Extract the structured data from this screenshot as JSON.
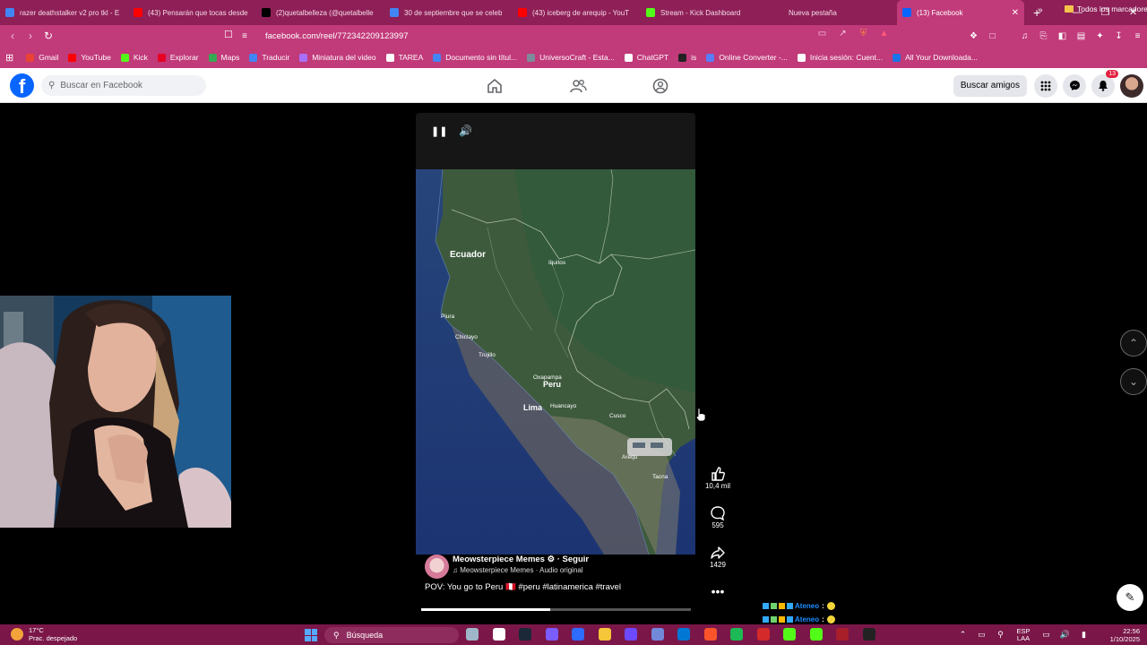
{
  "browser": {
    "tabs": [
      {
        "title": "razer deathstalker v2 pro tkl - E",
        "color": "#4285f4"
      },
      {
        "title": "(43) Pensarán que tocas desde",
        "color": "#ff0000"
      },
      {
        "title": "(2)quetalbelleza (@quetalbelle",
        "color": "#000000"
      },
      {
        "title": "30 de septiembre que se celeb",
        "color": "#4285f4"
      },
      {
        "title": "(43) iceberg de arequip - YouT",
        "color": "#ff0000"
      },
      {
        "title": "Stream - Kick Dashboard",
        "color": "#53fc18"
      },
      {
        "title": "Nueva pestaña",
        "color": "#8e1f57"
      },
      {
        "title": "(13) Facebook",
        "color": "#0866ff",
        "active": true
      }
    ],
    "url": "facebook.com/reel/772342209123997",
    "bookmarks": [
      {
        "label": "Gmail",
        "color": "#ea4335"
      },
      {
        "label": "YouTube",
        "color": "#ff0000"
      },
      {
        "label": "Kick",
        "color": "#53fc18"
      },
      {
        "label": "Explorar",
        "color": "#e60023"
      },
      {
        "label": "Maps",
        "color": "#34a853"
      },
      {
        "label": "Traducir",
        "color": "#4285f4"
      },
      {
        "label": "Miniatura del video",
        "color": "#a970ff"
      },
      {
        "label": "TAREA",
        "color": "#ffffff"
      },
      {
        "label": "Documento sin títul...",
        "color": "#4285f4"
      },
      {
        "label": "UniversoCraft - Esta...",
        "color": "#7d8b9c"
      },
      {
        "label": "ChatGPT",
        "color": "#ffffff"
      },
      {
        "label": "is",
        "color": "#222222"
      },
      {
        "label": "Online Converter -...",
        "color": "#5a7dff"
      },
      {
        "label": "Inicia sesión: Cuent...",
        "color": "#ffffff"
      },
      {
        "label": "All Your Downloada...",
        "color": "#1a73e8"
      }
    ],
    "bookmarks_folder": "Todos los marcadores",
    "window_controls": [
      "—",
      "❐",
      "✕"
    ]
  },
  "facebook": {
    "logo": "f",
    "search_placeholder": "Buscar en Facebook",
    "find_friends": "Buscar amigos",
    "notifications_count": "13",
    "brand_color": "#0866ff"
  },
  "reel": {
    "map_labels": {
      "ecuador": "Ecuador",
      "iquitos": "Iquitos",
      "piura": "Piura",
      "chiclayo": "Chiclayo",
      "trujillo": "Trujillo",
      "oxapampa": "Oxapampa",
      "peru": "Peru",
      "lima": "Lima",
      "huancayo": "Huancayo",
      "cusco": "Cusco",
      "arequipa": "Arequ",
      "tacna": "Tacna"
    },
    "author": "Meowsterpiece Memes ⚙ · Seguir",
    "audio": "♫ Meowsterpiece Memes · Audio original",
    "caption": "POV: You go to Peru 🇵🇪 #peru #latinamerica #travel",
    "progress": 0.48,
    "likes": "10,4 mil",
    "comments": "595",
    "shares": "1429"
  },
  "chat": [
    {
      "user": "Ateneo"
    },
    {
      "user": "Ateneo"
    }
  ],
  "taskbar": {
    "temperature": "17°C",
    "weather": "Prac. despejado",
    "search": "Búsqueda",
    "language": "ESP",
    "layout": "LAA",
    "time": "22:56",
    "date": "1/10/2025"
  }
}
